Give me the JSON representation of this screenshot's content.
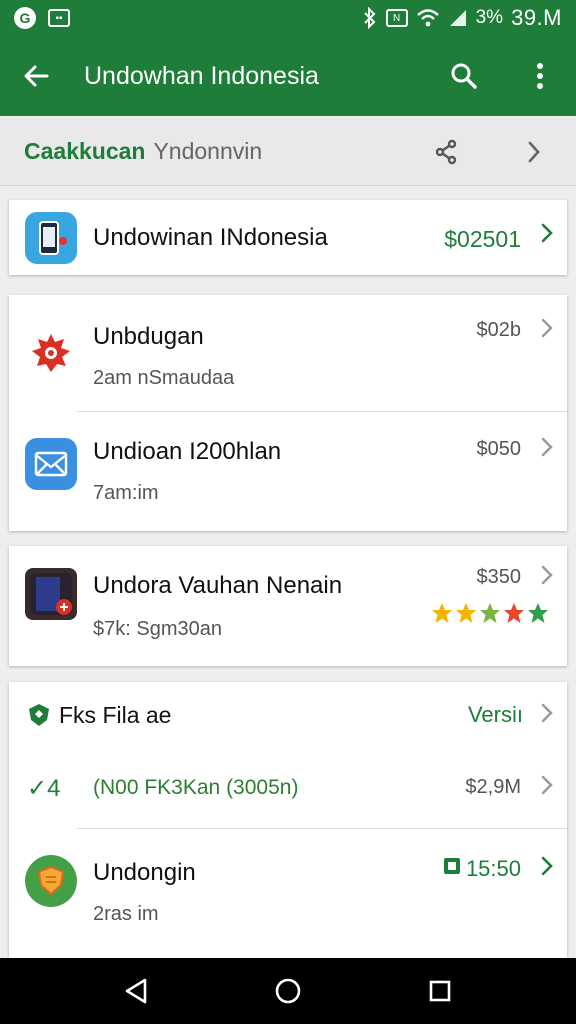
{
  "status_bar": {
    "time": "39.M",
    "battery": "3%",
    "icons": [
      "g-icon",
      "notification-box-icon",
      "bluetooth-icon",
      "nfc-icon",
      "wifi-icon",
      "signal-icon"
    ]
  },
  "app_bar": {
    "title": "Undowhan Indonesia"
  },
  "subheader": {
    "green_text": "Caakkucan",
    "gray_text": "Yndonnvin"
  },
  "card1": {
    "title": "Undowinan INdonesia",
    "price": "$02501"
  },
  "card2": {
    "items": [
      {
        "title": "Unbdugan",
        "subtitle": "2am nSmaudaa",
        "price": "$02b"
      },
      {
        "title": "Undioan I200hlan",
        "subtitle": "7am:im",
        "price": "$050"
      }
    ]
  },
  "card3": {
    "title": "Undora Vauhan Nenain",
    "subtitle": "$7k: Sgm30an",
    "price": "$350",
    "rating": 4
  },
  "card4": {
    "header_label": "Fks Fila ae",
    "header_action": "Versiı",
    "row2_prefix": "✓4",
    "row2_text": "(N00 FK3Kan (3005n)",
    "row2_price": "$2,9M",
    "row3_title": "Undongin",
    "row3_subtitle": "2ras im",
    "row3_price": "15:50"
  },
  "colors": {
    "primary": "#1e7d39",
    "accent_orange": "#e06a10"
  }
}
